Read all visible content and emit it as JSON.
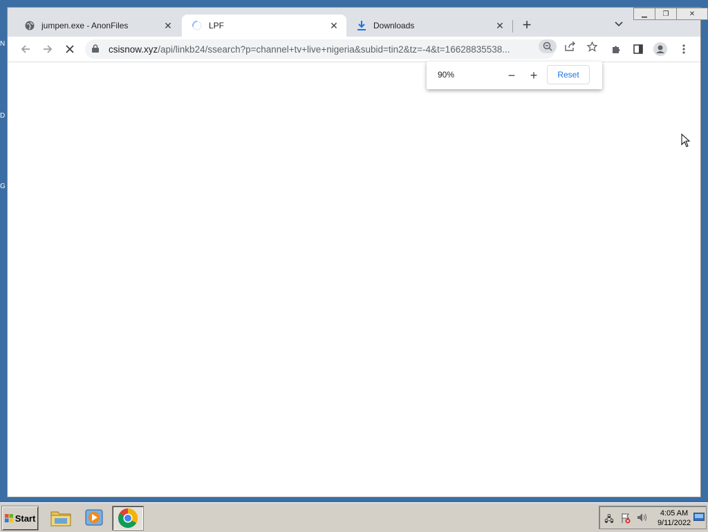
{
  "desktop": {
    "fragments": [
      "N",
      "D",
      "G"
    ]
  },
  "browser": {
    "tabs": [
      {
        "label": "jumpen.exe - AnonFiles",
        "icon": "globe-icon",
        "active": false
      },
      {
        "label": "LPF",
        "icon": "loading-spinner-icon",
        "active": true
      },
      {
        "label": "Downloads",
        "icon": "download-icon",
        "active": false
      }
    ],
    "url_host": "csisnow.xyz",
    "url_path": "/api/linkb24/ssearch?p=channel+tv+live+nigeria&subid=tin2&tz=-4&t=16628835538...",
    "zoom": {
      "percent": "90%",
      "reset_label": "Reset"
    }
  },
  "taskbar": {
    "start_label": "Start",
    "clock_time": "4:05 AM",
    "clock_date": "9/11/2022",
    "apps": [
      "file-explorer-icon",
      "media-player-icon",
      "chrome-icon"
    ]
  },
  "colors": {
    "desktop_bg": "#3a6ea5",
    "tabstrip_bg": "#dee1e6",
    "link_blue": "#1a73e8"
  }
}
